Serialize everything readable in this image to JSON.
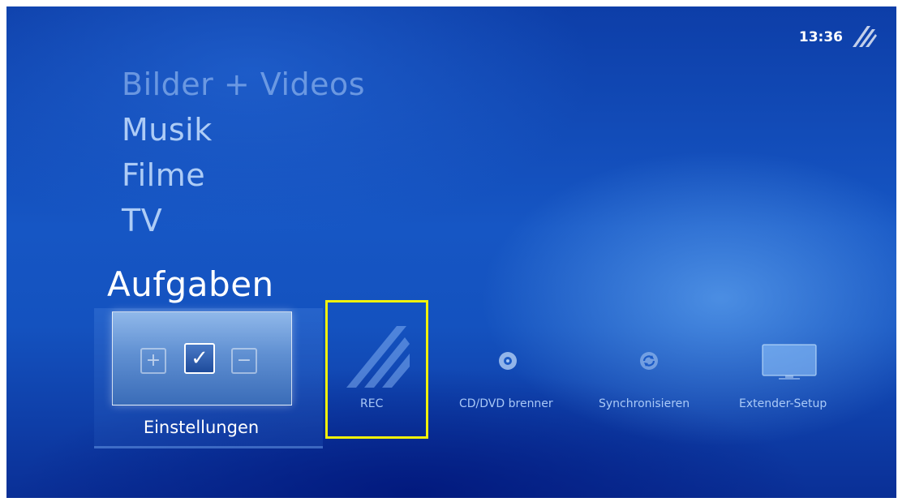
{
  "status": {
    "time": "13:36"
  },
  "menu": {
    "items": [
      {
        "label": "Bilder + Videos"
      },
      {
        "label": "Musik"
      },
      {
        "label": "Filme"
      },
      {
        "label": "TV"
      }
    ],
    "active": {
      "label": "Aufgaben"
    }
  },
  "tasks": {
    "selected_tile": {
      "label": "Einstellungen",
      "icon": "settings-checkbox-icon"
    },
    "items": [
      {
        "label": "REC",
        "icon": "media-center-logo-icon"
      },
      {
        "label": "CD/DVD brenner",
        "icon": "disc-icon"
      },
      {
        "label": "Synchronisieren",
        "icon": "sync-icon"
      },
      {
        "label": "Extender-Setup",
        "icon": "monitor-icon"
      }
    ]
  },
  "colors": {
    "focus_border": "#f1f20a",
    "background": "#1452bf"
  }
}
